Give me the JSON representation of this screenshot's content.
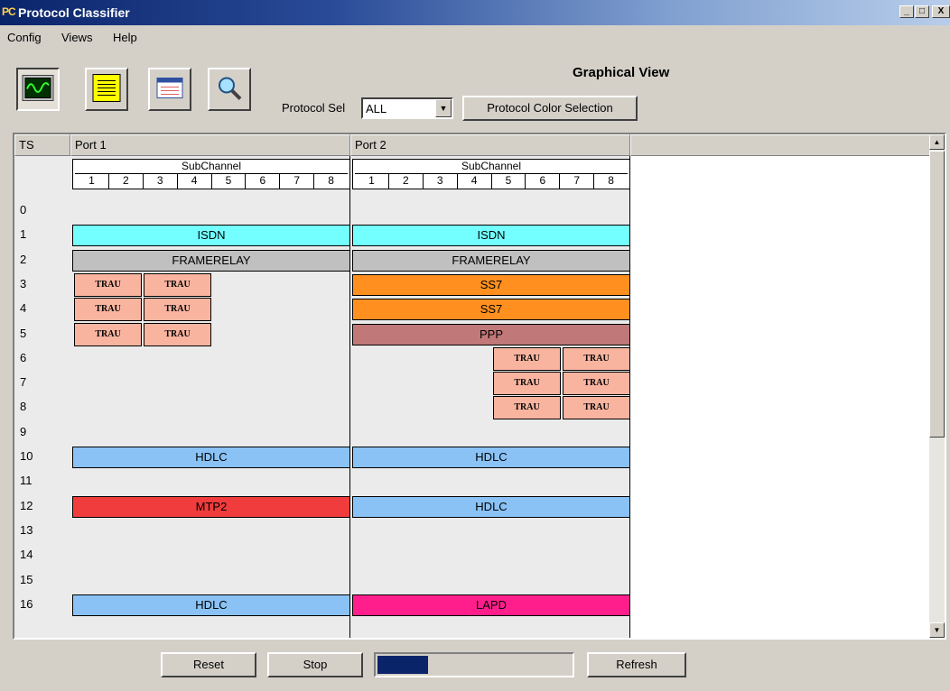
{
  "window": {
    "icon_text": "PC",
    "title": "Protocol Classifier",
    "min": "_",
    "max": "□",
    "close": "X"
  },
  "menu": [
    {
      "label": "Config"
    },
    {
      "label": "Views"
    },
    {
      "label": "Help"
    }
  ],
  "toolbar": {
    "buttons": [
      {
        "icon": "waveform-monitor-icon",
        "pressed": true
      },
      {
        "icon": "data-list-icon",
        "pressed": false
      },
      {
        "icon": "window-view-icon",
        "pressed": false
      },
      {
        "icon": "magnifier-icon",
        "pressed": false
      }
    ],
    "view_title": "Graphical View",
    "protocol_sel_label": "Protocol Sel",
    "protocol_sel_value": "ALL",
    "color_selection_label": "Protocol Color Selection"
  },
  "grid": {
    "headers": {
      "ts": "TS",
      "port1": "Port 1",
      "port2": "Port 2"
    },
    "subchannel_title": "SubChannel",
    "subchannels": [
      "1",
      "2",
      "3",
      "4",
      "5",
      "6",
      "7",
      "8"
    ],
    "timeslots": [
      "0",
      "1",
      "2",
      "3",
      "4",
      "5",
      "6",
      "7",
      "8",
      "9",
      "10",
      "11",
      "12",
      "13",
      "14",
      "15",
      "16"
    ],
    "port1": [
      {
        "ts": 1,
        "label": "ISDN",
        "color": "#73ffff"
      },
      {
        "ts": 2,
        "label": "FRAMERELAY",
        "color": "#c0c0c0"
      },
      {
        "ts": 10,
        "label": "HDLC",
        "color": "#8ac2f5"
      },
      {
        "ts": 12,
        "label": "MTP2",
        "color": "#f03c3c"
      },
      {
        "ts": 16,
        "label": "HDLC",
        "color": "#8ac2f5"
      }
    ],
    "port1_trau": {
      "rows": [
        3,
        4,
        5
      ],
      "subchannel_groups": [
        1,
        2
      ],
      "label": "TRAU"
    },
    "port2": [
      {
        "ts": 1,
        "label": "ISDN",
        "color": "#73ffff"
      },
      {
        "ts": 2,
        "label": "FRAMERELAY",
        "color": "#c0c0c0"
      },
      {
        "ts": 3,
        "label": "SS7",
        "color": "#ff9020"
      },
      {
        "ts": 4,
        "label": "SS7",
        "color": "#ff9020"
      },
      {
        "ts": 5,
        "label": "PPP",
        "color": "#c07878"
      },
      {
        "ts": 10,
        "label": "HDLC",
        "color": "#8ac2f5"
      },
      {
        "ts": 12,
        "label": "HDLC",
        "color": "#8ac2f5"
      },
      {
        "ts": 16,
        "label": "LAPD",
        "color": "#ff1e8c"
      }
    ],
    "port2_trau": {
      "rows": [
        6,
        7,
        8
      ],
      "subchannel_groups": [
        3,
        4
      ],
      "label": "TRAU"
    },
    "trau_color": "#f9b49f"
  },
  "bottom": {
    "reset": "Reset",
    "stop": "Stop",
    "progress_fraction": 0.26,
    "refresh": "Refresh"
  }
}
